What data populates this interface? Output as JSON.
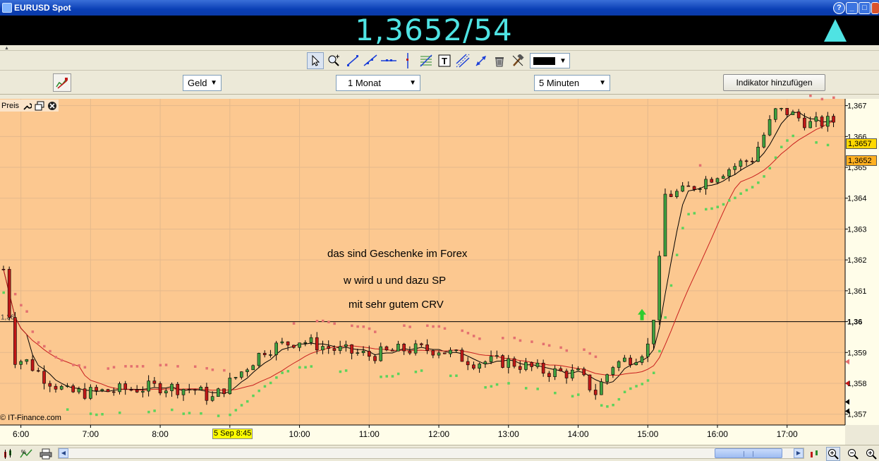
{
  "window": {
    "title": "EURUSD Spot"
  },
  "quote": {
    "price": "1,3652/54",
    "direction_icon": "up-arrow-icon",
    "color": "#4fe3e3"
  },
  "toolbar": {
    "tools": [
      "pointer-icon",
      "zoom-icon",
      "trendline-icon",
      "ray-icon",
      "horizontal-line-icon",
      "vertical-line-icon",
      "fibonacci-icon",
      "text-icon",
      "channel-icon",
      "arrow-draw-icon",
      "delete-icon",
      "hammer-icon"
    ],
    "line_color": "#000000"
  },
  "settings": {
    "price_type": "Geld",
    "period": "1 Monat",
    "interval": "5 Minuten",
    "add_indicator": "Indikator hinzufügen"
  },
  "panel": {
    "label": "Preis"
  },
  "annotations": [
    "das sind Geschenke im Forex",
    "w wird u und dazu SP",
    "mit sehr gutem CRV"
  ],
  "copyright": "© IT-Finance.com",
  "time_highlight": "5 Sep 8:45",
  "price_tags": {
    "bid": "1,3657",
    "ask": "1,3652"
  },
  "chart_data": {
    "type": "candlestick",
    "symbol": "EURUSD Spot",
    "interval": "5 Minuten",
    "xlim": [
      "5:42",
      "17:50"
    ],
    "ylim": [
      1.35665,
      1.36722
    ],
    "y_ticks": [
      "1,367",
      "1,366",
      "1,365",
      "1,364",
      "1,363",
      "1,362",
      "1,361",
      "1,36",
      "1,359",
      "1,358",
      "1,357"
    ],
    "y_tick_values": [
      1.367,
      1.366,
      1.365,
      1.364,
      1.363,
      1.362,
      1.361,
      1.36,
      1.359,
      1.358,
      1.357
    ],
    "x_ticks": [
      "6:00",
      "7:00",
      "8:00",
      "9:00",
      "10:00",
      "11:00",
      "12:00",
      "13:00",
      "14:00",
      "15:00",
      "16:00",
      "17:00"
    ],
    "grid": true,
    "reference_line": 1.36,
    "left_axis_label": "1,36",
    "bull_color": "#3fa03f",
    "bear_color": "#c01818",
    "background": "#fcc890",
    "anchors": [
      {
        "t": "5:45",
        "close": 1.3617
      },
      {
        "t": "5:55",
        "close": 1.3588
      },
      {
        "t": "6:05",
        "close": 1.3587
      },
      {
        "t": "6:20",
        "close": 1.3582
      },
      {
        "t": "6:40",
        "close": 1.3577
      },
      {
        "t": "7:00",
        "close": 1.3577
      },
      {
        "t": "7:30",
        "close": 1.3578
      },
      {
        "t": "8:00",
        "close": 1.3579
      },
      {
        "t": "8:30",
        "close": 1.3578
      },
      {
        "t": "8:45",
        "close": 1.3575
      },
      {
        "t": "9:05",
        "close": 1.3582
      },
      {
        "t": "9:30",
        "close": 1.3591
      },
      {
        "t": "10:00",
        "close": 1.3594
      },
      {
        "t": "10:30",
        "close": 1.3591
      },
      {
        "t": "11:00",
        "close": 1.3589
      },
      {
        "t": "11:30",
        "close": 1.3591
      },
      {
        "t": "12:00",
        "close": 1.3591
      },
      {
        "t": "12:30",
        "close": 1.3587
      },
      {
        "t": "13:00",
        "close": 1.3587
      },
      {
        "t": "13:30",
        "close": 1.3584
      },
      {
        "t": "14:00",
        "close": 1.3583
      },
      {
        "t": "14:15",
        "close": 1.3577
      },
      {
        "t": "14:30",
        "close": 1.3586
      },
      {
        "t": "14:50",
        "close": 1.3589
      },
      {
        "t": "15:00",
        "close": 1.3592
      },
      {
        "t": "15:05",
        "close": 1.3602
      },
      {
        "t": "15:10",
        "close": 1.3619
      },
      {
        "t": "15:15",
        "close": 1.3641
      },
      {
        "t": "15:30",
        "close": 1.3642
      },
      {
        "t": "16:00",
        "close": 1.3648
      },
      {
        "t": "16:30",
        "close": 1.3653
      },
      {
        "t": "16:50",
        "close": 1.3668
      },
      {
        "t": "17:00",
        "close": 1.3668
      },
      {
        "t": "17:20",
        "close": 1.3664
      },
      {
        "t": "17:40",
        "close": 1.3665
      }
    ],
    "series": [
      {
        "name": "",
        "kind": "moving-average",
        "color": "#000000",
        "period": 5
      },
      {
        "name": "",
        "kind": "moving-average",
        "color": "#c81e1e",
        "period": 14
      },
      {
        "name": "",
        "kind": "parabolic-sar",
        "bullish_color": "#5bd35b",
        "bearish_color": "#e37070"
      }
    ],
    "signal": {
      "type": "buy-arrow",
      "t": "14:55",
      "price": 1.36,
      "color": "#2ecc2e"
    }
  }
}
